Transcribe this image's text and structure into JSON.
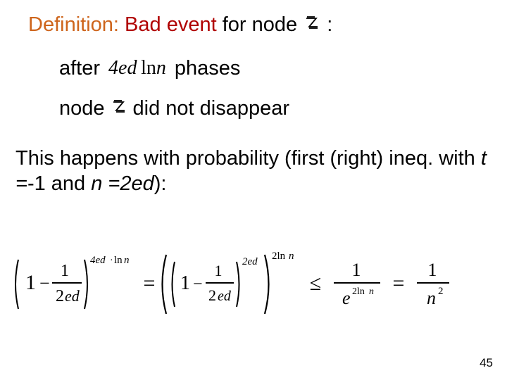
{
  "title": {
    "def_label": "Definition:",
    "bad_event_label": "Bad event",
    "for_node_label": "for node",
    "z_symbol": "z",
    "colon": ":"
  },
  "line_after": {
    "after": "after",
    "phases": "phases",
    "expr_4ed": "4ed",
    "expr_ln": "ln",
    "expr_n": "n"
  },
  "line_node": {
    "node": "node",
    "z_symbol": "z",
    "did_not": "did not disappear"
  },
  "paragraph": {
    "text_a": "This happens with probability (first (right) ineq. with",
    "t_eq": "t =",
    "neg_one": "-1 and",
    "n_eq": "n =",
    "two_ed": "2ed",
    "tail": "):"
  },
  "equation": {
    "lhs_exp_factor": "4ed",
    "lhs_exp_dot": "·",
    "lhs_exp_ln": "ln",
    "lhs_exp_n": "n",
    "inner_exp": "2ed",
    "outer_exp": "2ln",
    "outer_exp_n": "n",
    "frac1_num": "1",
    "frac1_den_2": "2",
    "frac1_den_ed": "ed",
    "rhs1_num": "1",
    "rhs1_den_e": "e",
    "rhs1_den_exp": "2ln",
    "rhs1_den_exp_n": "n",
    "rhs2_num": "1",
    "rhs2_den_n": "n",
    "rhs2_den_exp": "2",
    "one": "1",
    "minus": "−",
    "eq": "=",
    "le": "≤"
  },
  "page_number": "45"
}
